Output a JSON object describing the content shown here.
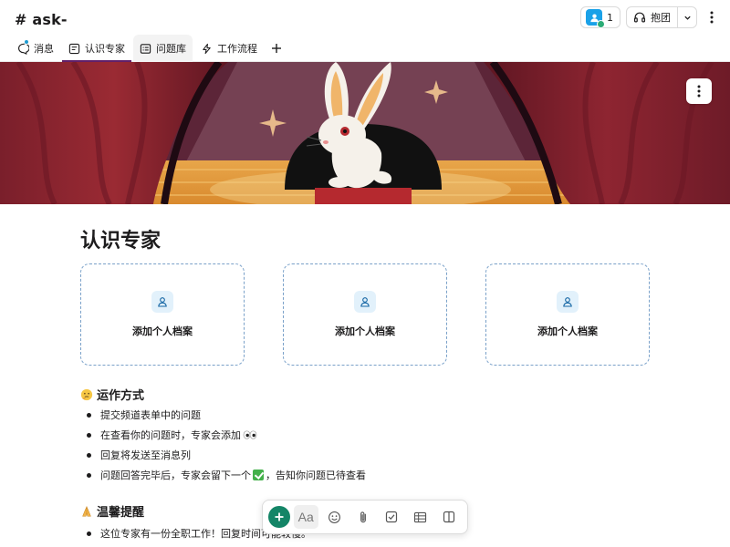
{
  "channel": {
    "title": "# ask-"
  },
  "header": {
    "member_count": "1",
    "huddle_label": "抱团"
  },
  "tabs": [
    {
      "label": "消息"
    },
    {
      "label": "认识专家"
    },
    {
      "label": "问题库"
    },
    {
      "label": "工作流程"
    }
  ],
  "page": {
    "title": "认识专家",
    "cards": [
      {
        "label": "添加个人档案"
      },
      {
        "label": "添加个人档案"
      },
      {
        "label": "添加个人档案"
      }
    ],
    "section1": {
      "heading": "运作方式",
      "emoji": "thinking-face",
      "items": [
        "提交频道表单中的问题",
        "在查看你的问题时，专家会添加",
        "回复将发送至消息列",
        "问题回答完毕后，专家会留下一个",
        "，告知你问题已待查看"
      ]
    },
    "section2": {
      "heading": "温馨提醒",
      "emoji": "folded-hands",
      "items": [
        "这位专家有一份全职工作！回复时间可能较慢。"
      ]
    }
  },
  "toolbar": {
    "text_format_label": "Aa"
  },
  "colors": {
    "accent": "#611f69",
    "green": "#148567",
    "card_border": "#7aa1c9",
    "badge_blue": "#1d9bd1"
  }
}
